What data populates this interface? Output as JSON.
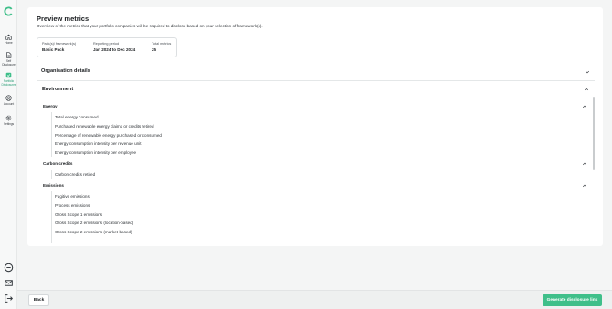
{
  "sidebar": {
    "items": [
      {
        "label": "Home",
        "icon": "home-icon"
      },
      {
        "label": "Self Disclosure",
        "icon": "document-icon"
      },
      {
        "label": "Portfolio Disclosures",
        "icon": "portfolio-icon",
        "active": true
      },
      {
        "label": "Account",
        "icon": "account-icon"
      },
      {
        "label": "Settings",
        "icon": "gear-icon"
      }
    ],
    "bottom_icons": [
      "chat-icon",
      "mail-icon",
      "logout-icon"
    ]
  },
  "page": {
    "title": "Preview metrics",
    "subtitle": "Overview of the metrics that your portfolio companies will be required to disclose based on your selection of framework(s)."
  },
  "summary": {
    "pack_label": "Pack(s)/ framework(s)",
    "pack_value": "Basic Pack",
    "period_label": "Reporting period",
    "period_value": "Jan 2024 to Dec 2024",
    "total_label": "Total metrics",
    "total_value": "25"
  },
  "sections": {
    "organisation": "Organisation details",
    "environment": "Environment"
  },
  "groups": [
    {
      "title": "Energy",
      "metrics": [
        "Total energy consumed",
        "Purchased renewable energy claims or credits retired",
        "Percentage of renewable energy purchased or consumed",
        "Energy consumption intensity per revenue unit",
        "Energy consumption intensity per employee"
      ]
    },
    {
      "title": "Carbon credits",
      "metrics": [
        "Carbon credits retired"
      ]
    },
    {
      "title": "Emissions",
      "metrics": [
        "Fugitive emissions",
        "Process emissions",
        "Gross Scope 1 emissions",
        "Gross Scope 2 emissions (location-based)",
        "Gross Scope 2 emissions (market-based)"
      ]
    }
  ],
  "footer": {
    "back_label": "Back",
    "generate_label": "Generate disclosure link"
  },
  "colors": {
    "accent": "#3fbf8a",
    "accent_border": "#7ed8b8"
  }
}
